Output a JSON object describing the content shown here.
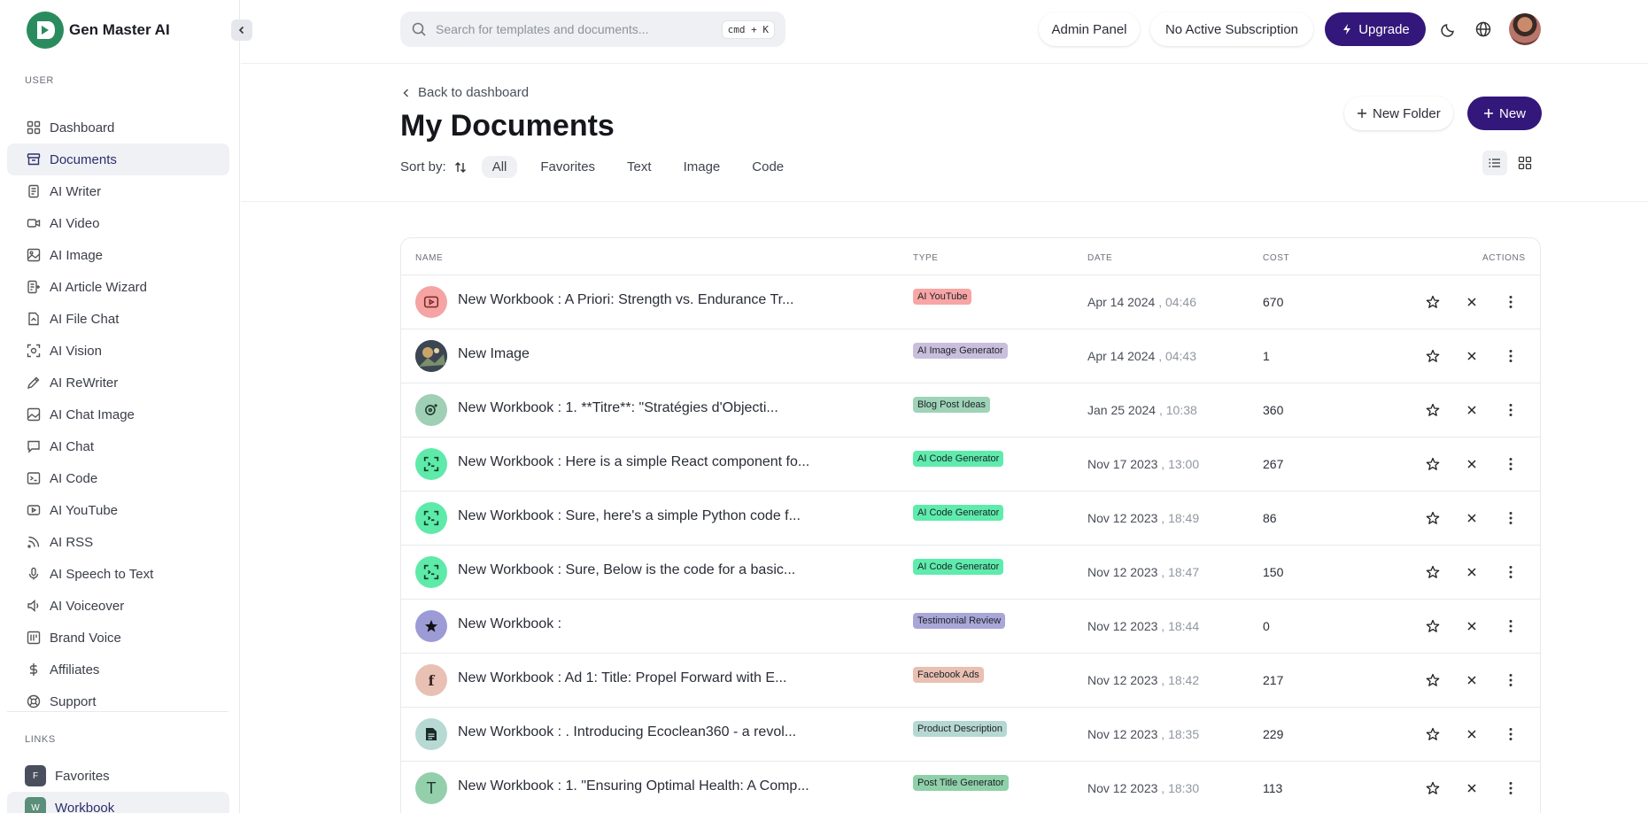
{
  "brand": {
    "name": "Gen Master AI"
  },
  "sidebar": {
    "user_label": "USER",
    "links_label": "LINKS",
    "items": [
      {
        "label": "Dashboard",
        "icon": "grid-icon"
      },
      {
        "label": "Documents",
        "icon": "archive-icon",
        "active": true
      },
      {
        "label": "AI Writer",
        "icon": "document-icon"
      },
      {
        "label": "AI Video",
        "icon": "video-icon"
      },
      {
        "label": "AI Image",
        "icon": "image-icon"
      },
      {
        "label": "AI Article Wizard",
        "icon": "wizard-icon"
      },
      {
        "label": "AI File Chat",
        "icon": "file-chat-icon"
      },
      {
        "label": "AI Vision",
        "icon": "scan-icon"
      },
      {
        "label": "AI ReWriter",
        "icon": "pencil-icon"
      },
      {
        "label": "AI Chat Image",
        "icon": "chat-image-icon"
      },
      {
        "label": "AI Chat",
        "icon": "chat-icon"
      },
      {
        "label": "AI Code",
        "icon": "terminal-icon"
      },
      {
        "label": "AI YouTube",
        "icon": "youtube-icon"
      },
      {
        "label": "AI RSS",
        "icon": "rss-icon"
      },
      {
        "label": "AI Speech to Text",
        "icon": "microphone-icon"
      },
      {
        "label": "AI Voiceover",
        "icon": "speaker-icon"
      },
      {
        "label": "Brand Voice",
        "icon": "brand-icon"
      },
      {
        "label": "Affiliates",
        "icon": "dollar-icon"
      },
      {
        "label": "Support",
        "icon": "lifebuoy-icon"
      }
    ],
    "links": [
      {
        "label": "Favorites",
        "badge": "F",
        "color": "#4a4f5e"
      },
      {
        "label": "Workbook",
        "badge": "W",
        "color": "#5b8f7a",
        "active": true
      }
    ]
  },
  "topbar": {
    "search_placeholder": "Search for templates and documents...",
    "shortcut": "cmd + K",
    "admin_panel": "Admin Panel",
    "subscription": "No Active Subscription",
    "upgrade": "Upgrade"
  },
  "header": {
    "back": "Back to dashboard",
    "title": "My Documents",
    "sort_by": "Sort by:",
    "filters": [
      "All",
      "Favorites",
      "Text",
      "Image",
      "Code"
    ],
    "new_folder": "New Folder",
    "new": "New"
  },
  "table": {
    "columns": {
      "name": "NAME",
      "type": "TYPE",
      "date": "DATE",
      "cost": "COST",
      "actions": "ACTIONS"
    },
    "rows": [
      {
        "name": "New Workbook : A Priori: Strength vs. Endurance Tr...",
        "type": "AI YouTube",
        "type_color": "#f7a5a5",
        "date": "Apr 14 2024",
        "time": ", 04:46",
        "cost": "670",
        "icon": "youtube-icon",
        "icon_bg": "#f5a3a3"
      },
      {
        "name": "New Image",
        "type": "AI Image Generator",
        "type_color": "#c9bfdc",
        "date": "Apr 14 2024",
        "time": ", 04:43",
        "cost": "1",
        "icon": "image-thumbnail",
        "icon_bg": "#4a5560"
      },
      {
        "name": "New Workbook : 1. **Titre**: \"Stratégies d'Objecti...",
        "type": "Blog Post Ideas",
        "type_color": "#9ed3b7",
        "date": "Jan 25 2024",
        "time": ", 10:38",
        "cost": "360",
        "icon": "ideas-icon",
        "icon_bg": "#9fcfb5"
      },
      {
        "name": "New Workbook : Here is a simple React component fo...",
        "type": "AI Code Generator",
        "type_color": "#5eecac",
        "date": "Nov 17 2023",
        "time": ", 13:00",
        "cost": "267",
        "icon": "code-scan-icon",
        "icon_bg": "#5eeaa8"
      },
      {
        "name": "New Workbook : Sure, here's a simple Python code f...",
        "type": "AI Code Generator",
        "type_color": "#5eecac",
        "date": "Nov 12 2023",
        "time": ", 18:49",
        "cost": "86",
        "icon": "code-scan-icon",
        "icon_bg": "#5eeaa8"
      },
      {
        "name": "New Workbook : Sure, Below is the code for a basic...",
        "type": "AI Code Generator",
        "type_color": "#5eecac",
        "date": "Nov 12 2023",
        "time": ", 18:47",
        "cost": "150",
        "icon": "code-scan-icon",
        "icon_bg": "#5eeaa8"
      },
      {
        "name": "New Workbook :",
        "type": "Testimonial Review",
        "type_color": "#a9a7d8",
        "date": "Nov 12 2023",
        "time": ", 18:44",
        "cost": "0",
        "icon": "star-filled-icon",
        "icon_bg": "#9c9bd6"
      },
      {
        "name": "New Workbook : Ad 1: Title: Propel Forward with E...",
        "type": "Facebook Ads",
        "type_color": "#e9c0b2",
        "date": "Nov 12 2023",
        "time": ", 18:42",
        "cost": "217",
        "icon": "facebook-icon",
        "icon_bg": "#e8c1b4"
      },
      {
        "name": "New Workbook : . Introducing Ecoclean360 - a revol...",
        "type": "Product Description",
        "type_color": "#b6d8d2",
        "date": "Nov 12 2023",
        "time": ", 18:35",
        "cost": "229",
        "icon": "document-filled-icon",
        "icon_bg": "#b7d9d3"
      },
      {
        "name": "New Workbook : 1. \"Ensuring Optimal Health: A Comp...",
        "type": "Post Title Generator",
        "type_color": "#8fd0a8",
        "date": "Nov 12 2023",
        "time": ", 18:30",
        "cost": "113",
        "icon": "title-icon",
        "icon_bg": "#93cfab"
      }
    ]
  }
}
